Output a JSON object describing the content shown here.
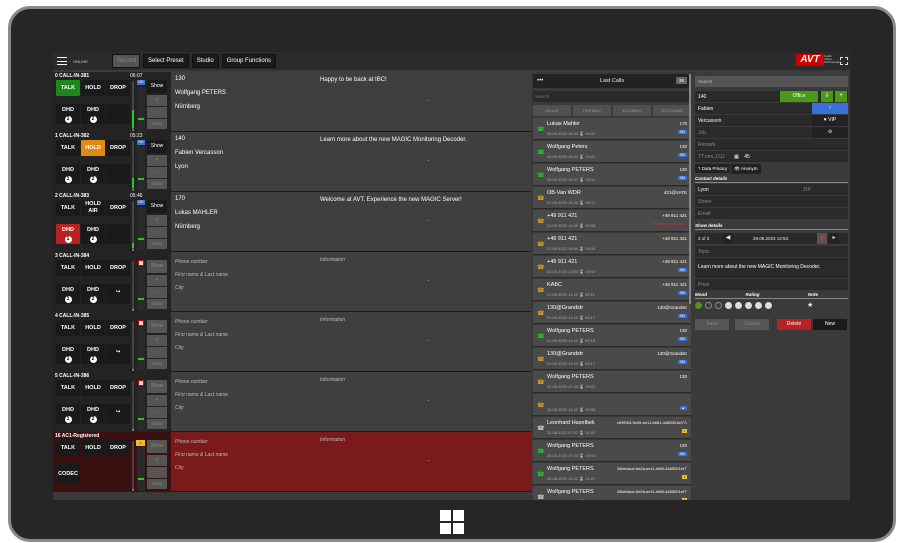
{
  "topbar": {
    "online": "ONLINE",
    "dim_button": "Record",
    "buttons": [
      "Select Preset",
      "Studio",
      "Group Functions"
    ],
    "logo": "AVT",
    "logo_sub": "Audio Video Technologies"
  },
  "lines": [
    {
      "name": "0 CALL-IN-381",
      "time": "06:07",
      "talk": "TALK",
      "hold": "HOLD",
      "drop": "DROP",
      "dhd": "DHD",
      "show": "Show",
      "clear": "Clear",
      "number": "130",
      "caller": "Wolfgang PETERS",
      "city": "Nürnberg",
      "info": "Happy to be back at IBC!"
    },
    {
      "name": "1 CALL-IN-382",
      "time": "05:23",
      "talk": "TALK",
      "hold": "HOLD",
      "drop": "DROP",
      "dhd": "DHD",
      "show": "Show",
      "clear": "Clear",
      "number": "140",
      "caller": "Fabien Vercasson",
      "city": "Lyon",
      "info": "Learn more about the new MAGIC Monitoring Decoder."
    },
    {
      "name": "2 CALL-IN-383",
      "time": "05:46",
      "talk": "TALK",
      "hold": "HOLD AIR",
      "drop": "DROP",
      "dhd": "DHD",
      "show": "Show",
      "clear": "Clear",
      "number": "170",
      "caller": "Lukas MAHLER",
      "city": "Nürnberg",
      "info": "Welcome at AVT. Experience the new MAGIC Server!"
    },
    {
      "name": "3 CALL-IN-384",
      "time": "",
      "talk": "TALK",
      "hold": "HOLD",
      "drop": "DROP",
      "dhd": "DHD",
      "show": "Show",
      "clear": "Clear",
      "number": "Phone number",
      "caller": "First name & Last name",
      "city": "City",
      "info": "Information"
    },
    {
      "name": "4 CALL-IN-385",
      "time": "",
      "talk": "TALK",
      "hold": "HOLD",
      "drop": "DROP",
      "dhd": "DHD",
      "show": "Show",
      "clear": "Clear",
      "number": "Phone number",
      "caller": "First name & Last name",
      "city": "City",
      "info": "Information"
    },
    {
      "name": "5 CALL-IN-386",
      "time": "",
      "talk": "TALK",
      "hold": "HOLD",
      "drop": "DROP",
      "dhd": "DHD",
      "show": "Show",
      "clear": "Clear",
      "number": "Phone number",
      "caller": "First name & Last name",
      "city": "City",
      "info": "Information"
    },
    {
      "name": "16 AC1-Registered",
      "time": "",
      "talk": "TALK",
      "hold": "HOLD",
      "drop": "DROP",
      "codec": "CODEC",
      "show": "Show",
      "clear": "Clear",
      "number": "Phone number",
      "caller": "First name & Last name",
      "city": "City",
      "info": "Information"
    }
  ],
  "last_calls": {
    "title": "Last Calls",
    "count": "35",
    "search": "Search",
    "tabs": [
      "ON AIR",
      "PRETALK",
      "INCOMING",
      "OUTGOING"
    ],
    "entries": [
      {
        "name": "Lukas Mahler",
        "num": "170",
        "sub": "04.09.2023 16:04  ⌛ 00:22",
        "tag": "HD"
      },
      {
        "name": "Wolfgang Peters",
        "num": "130",
        "sub": "04.09.2023 16:04  ⌛ 00:22",
        "tag": "HD"
      },
      {
        "name": "Wolfgang PETERS",
        "num": "130",
        "sub": "04.09.2023 15:47  ⌛ 00:11",
        "tag": "HD"
      },
      {
        "name": "OB-Van WDR",
        "num": "421@VATE",
        "sub": "01.09.2023 15:46  ⌛ 00:11",
        "tag": ""
      },
      {
        "name": "+49 911 421",
        "num": "+49 911 421",
        "sub": "01.09.2023 14:09  ⌛ 00:08",
        "tag": "Temporarily unavaila"
      },
      {
        "name": "+49 911 421",
        "num": "+49 911 421",
        "sub": "01.09.2023 14:09  ⌛ 00:16",
        "tag": ""
      },
      {
        "name": "+49 911 421",
        "num": "+49 911 421",
        "sub": "01.09.2023 13:54  ⌛ 00:02",
        "tag": "HD"
      },
      {
        "name": "KABC",
        "num": "+49 911 421",
        "sub": "01.09.2023 11:49  ⌛ 00:11",
        "tag": "HD"
      },
      {
        "name": "130@Grandstr",
        "num": "130@Grandstr",
        "sub": "01.09.2023 11:45  ⌛ 00:17",
        "tag": "HD"
      },
      {
        "name": "Wolfgang PETERS",
        "num": "130",
        "sub": "01.09.2023 11:45  ⌛ 00:18",
        "tag": "HD"
      },
      {
        "name": "130@Grandstr",
        "num": "130@Grandstr",
        "sub": "01.09.2023 11:44  ⌛ 00:17",
        "tag": "HD"
      },
      {
        "name": "Wolfgang PETERS",
        "num": "130",
        "sub": "31.08.2023 17:45  ⌛ 00:02",
        "tag": ""
      },
      {
        "name": "",
        "num": "",
        "sub": "31.08.2023 14:12  ⌛ 00:05",
        "tag": "▲"
      },
      {
        "name": "Leonhard Haselbek",
        "num": "c59f394-9c45-ee11-b681-4485001ef77a",
        "sub": "31.08.2023 07:57  ⌛ 01:51",
        "tag": "▪"
      },
      {
        "name": "Wolfgang PETERS",
        "num": "130",
        "sub": "30.08.2023 17:24  ⌛ 00:03",
        "tag": "HD"
      },
      {
        "name": "Wolfgang PETERS",
        "num": "28bb4ace-bb2a-ee11-b66f-4485001ef77a",
        "sub": "30.08.2023 16:22  ⌛ 01:27",
        "tag": "▪"
      },
      {
        "name": "Wolfgang PETERS",
        "num": "28bb4ace-bb2a-ee11-b66f-4485001ef77a",
        "sub": "30.08.2023 16:01  ⌛ 04:27",
        "tag": "▪"
      }
    ]
  },
  "details": {
    "search": "Search",
    "number": "140",
    "office": "Office",
    "firstname": "Fabien",
    "lastname": "Vercasson",
    "vip": "VIP",
    "role": "Job",
    "remark": "Remark",
    "date_placeholder": "TT.mm.JJJJ",
    "age": "45",
    "data_privacy": "Data Privacy",
    "anonym": "Anonym",
    "contact_title": "Contact details",
    "city": "Lyon",
    "zip": "ZIP",
    "street": "Street",
    "email": "Email",
    "show_title": "Show details",
    "counter": "3 of 3",
    "datetime": "29.08.2023 14:53",
    "topic": "Topic",
    "info": "Learn more about the new MAGIC Monitoring Decoder.",
    "prize": "Prize",
    "mood": "Mood",
    "rating": "Rating",
    "note": "Note",
    "save": "Save",
    "cancel": "Cancel",
    "delete": "Delete",
    "new": "New"
  }
}
